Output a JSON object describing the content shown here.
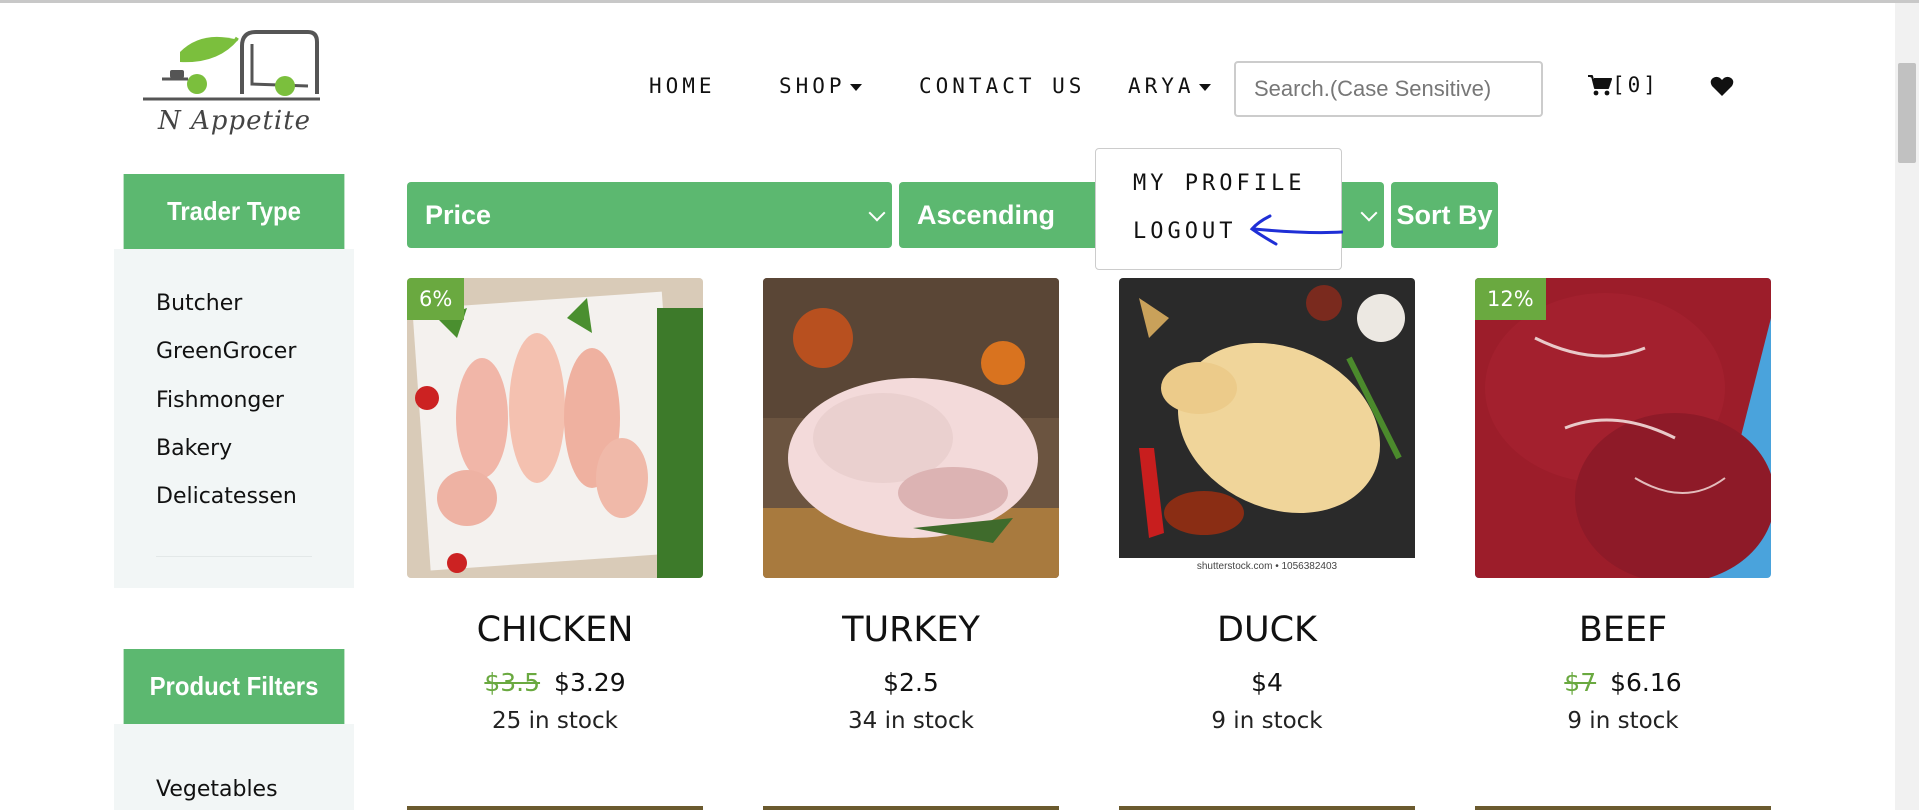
{
  "brand": {
    "logo_text": "N Appetite"
  },
  "nav": {
    "home": "HOME",
    "shop": "SHOP",
    "contact": "CONTACT US",
    "user": "ARYA",
    "search_placeholder": "Search.(Case Sensitive)",
    "cart": "[0]"
  },
  "user_menu": {
    "items": [
      "MY PROFILE",
      "LOGOUT"
    ]
  },
  "sidebar": {
    "trader_type": {
      "title": "Trader Type",
      "items": [
        "Butcher",
        "GreenGrocer",
        "Fishmonger",
        "Bakery",
        "Delicatessen"
      ]
    },
    "product_filters": {
      "title": "Product Filters",
      "items": [
        "Vegetables"
      ]
    }
  },
  "sort": {
    "field": "Price",
    "order": "Ascending",
    "button": "Sort By"
  },
  "products": [
    {
      "name": "CHICKEN",
      "old_price": "$3.5",
      "price": "$3.29",
      "stock": "25 in stock",
      "badge": "6%"
    },
    {
      "name": "TURKEY",
      "old_price": "",
      "price": "$2.5",
      "stock": "34 in stock",
      "badge": ""
    },
    {
      "name": "DUCK",
      "old_price": "",
      "price": "$4",
      "stock": "9 in stock",
      "badge": "",
      "image_credit": "shutterstock.com • 1056382403"
    },
    {
      "name": "BEEF",
      "old_price": "$7",
      "price": "$6.16",
      "stock": "9 in stock",
      "badge": "12%"
    }
  ],
  "colors": {
    "accent": "#5cb870",
    "badge": "#6aa940",
    "sidebar_bg": "#f2f6f6",
    "annotation": "#1f2fd6"
  }
}
